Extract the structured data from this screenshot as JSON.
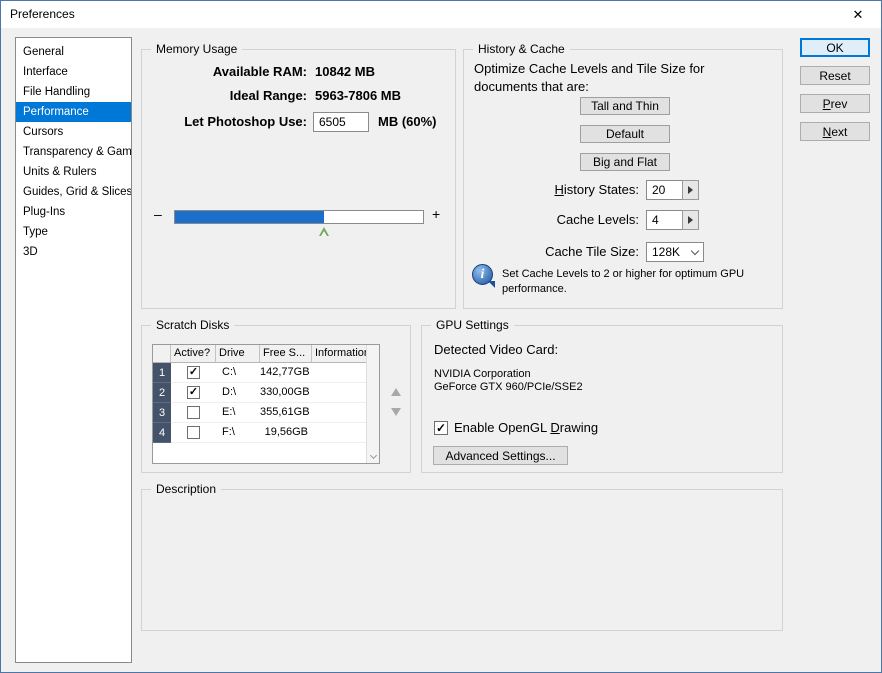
{
  "colors": {
    "accent": "#0078d7",
    "slider_fill": "#1c6fca",
    "row_num_bg": "#44536a"
  },
  "window": {
    "title": "Preferences",
    "close_glyph": "✕"
  },
  "sidebar": {
    "items": [
      {
        "label": "General"
      },
      {
        "label": "Interface"
      },
      {
        "label": "File Handling"
      },
      {
        "label": "Performance"
      },
      {
        "label": "Cursors"
      },
      {
        "label": "Transparency & Gamut"
      },
      {
        "label": "Units & Rulers"
      },
      {
        "label": "Guides, Grid & Slices"
      },
      {
        "label": "Plug-Ins"
      },
      {
        "label": "Type"
      },
      {
        "label": "3D"
      }
    ]
  },
  "memory": {
    "title": "Memory Usage",
    "available_label": "Available RAM:",
    "available_value": "10842 MB",
    "ideal_label": "Ideal Range:",
    "ideal_value": "5963-7806 MB",
    "let_label": "Let Photoshop Use:",
    "let_value": "6505",
    "let_suffix": "MB (60%)",
    "slider_minus": "–",
    "slider_plus": "+",
    "slider_percent": 60
  },
  "history_cache": {
    "title": "History & Cache",
    "optimize_text": "Optimize Cache Levels and Tile Size for documents that are:",
    "preset_buttons": [
      {
        "label": "Tall and Thin"
      },
      {
        "label": "Default"
      },
      {
        "label": "Big and Flat"
      }
    ],
    "history_states": {
      "label_u": "H",
      "label_rest": "istory States:",
      "value": "20"
    },
    "cache_levels": {
      "label": "Cache Levels:",
      "value": "4"
    },
    "cache_tile": {
      "label": "Cache Tile Size:",
      "value": "128K"
    },
    "info_text": "Set Cache Levels to 2 or higher for optimum GPU performance."
  },
  "actions": {
    "ok": "OK",
    "reset": "Reset",
    "prev_u": "P",
    "prev_rest": "rev",
    "next_u": "N",
    "next_rest": "ext"
  },
  "scratch": {
    "title": "Scratch Disks",
    "columns": [
      {
        "label": ""
      },
      {
        "label": "Active?"
      },
      {
        "label": "Drive"
      },
      {
        "label": "Free S..."
      },
      {
        "label": "Information"
      }
    ],
    "rows": [
      {
        "num": "1",
        "check": "✓",
        "drive": "C:\\",
        "free": "142,77GB",
        "info": ""
      },
      {
        "num": "2",
        "check": "✓",
        "drive": "D:\\",
        "free": "330,00GB",
        "info": ""
      },
      {
        "num": "3",
        "check": "",
        "drive": "E:\\",
        "free": "355,61GB",
        "info": ""
      },
      {
        "num": "4",
        "check": "",
        "drive": "F:\\",
        "free": "19,56GB",
        "info": ""
      }
    ]
  },
  "gpu": {
    "title": "GPU Settings",
    "detected_label": "Detected Video Card:",
    "card_vendor": "NVIDIA Corporation",
    "card_model": "GeForce GTX 960/PCIe/SSE2",
    "opengl_check": "✓",
    "opengl_pre": "Enable OpenGL ",
    "opengl_u": "D",
    "opengl_rest": "rawing",
    "advanced_label": "Advanced Settings..."
  },
  "description": {
    "title": "Description"
  }
}
